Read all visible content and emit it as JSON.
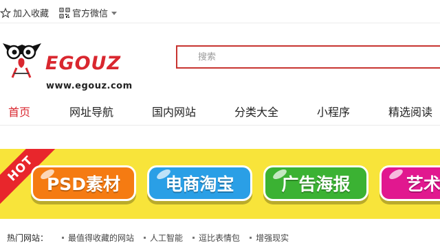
{
  "topbar": {
    "favorite_label": "加入收藏",
    "wechat_label": "官方微信"
  },
  "logo": {
    "word": "EGOUZ",
    "url": "www.egouz.com"
  },
  "search": {
    "placeholder": "搜索"
  },
  "nav": {
    "items": [
      {
        "label": "首页",
        "active": true
      },
      {
        "label": "网址导航"
      },
      {
        "label": "国内网站"
      },
      {
        "label": "分类大全"
      },
      {
        "label": "小程序"
      },
      {
        "label": "精选阅读"
      }
    ]
  },
  "banner": {
    "hot_label": "HOT",
    "buttons": [
      {
        "label": "PSD素材",
        "color": "#f57b12"
      },
      {
        "label": "电商淘宝",
        "color": "#2a9fe6"
      },
      {
        "label": "广告海报",
        "color": "#3bb233"
      },
      {
        "label": "艺术字",
        "color": "#e1188f"
      }
    ],
    "background": "#f8e43a"
  },
  "hot_sites": {
    "label": "热门网站：",
    "links": [
      "最值得收藏的网站",
      "人工智能",
      "逗比表情包",
      "增强现实"
    ]
  },
  "colors": {
    "brand_red": "#d9272f"
  }
}
